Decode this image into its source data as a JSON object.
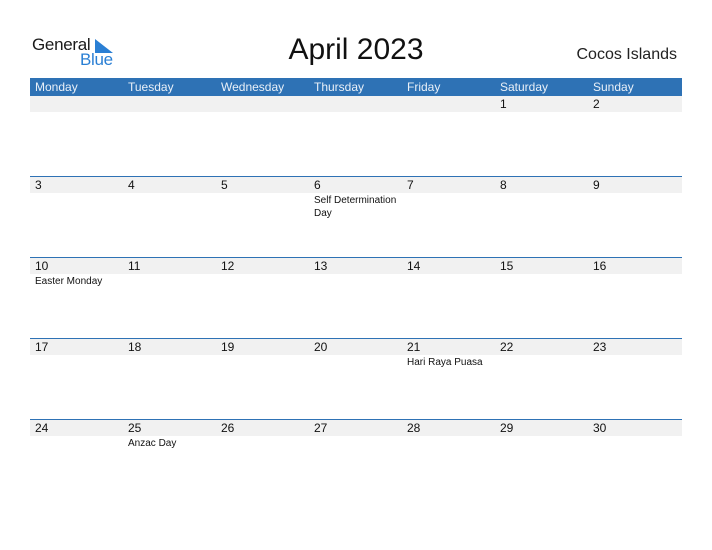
{
  "logo": {
    "part1": "General",
    "part2": "Blue"
  },
  "title": "April 2023",
  "country": "Cocos Islands",
  "colors": {
    "header": "#2e72b5",
    "logo_blue": "#2a7fd4",
    "band": "#f1f1f1"
  },
  "weekdays": [
    "Monday",
    "Tuesday",
    "Wednesday",
    "Thursday",
    "Friday",
    "Saturday",
    "Sunday"
  ],
  "weeks": [
    {
      "days": [
        {
          "num": "",
          "holiday": ""
        },
        {
          "num": "",
          "holiday": ""
        },
        {
          "num": "",
          "holiday": ""
        },
        {
          "num": "",
          "holiday": ""
        },
        {
          "num": "",
          "holiday": ""
        },
        {
          "num": "1",
          "holiday": ""
        },
        {
          "num": "2",
          "holiday": ""
        }
      ]
    },
    {
      "days": [
        {
          "num": "3",
          "holiday": ""
        },
        {
          "num": "4",
          "holiday": ""
        },
        {
          "num": "5",
          "holiday": ""
        },
        {
          "num": "6",
          "holiday": "Self Determination Day"
        },
        {
          "num": "7",
          "holiday": ""
        },
        {
          "num": "8",
          "holiday": ""
        },
        {
          "num": "9",
          "holiday": ""
        }
      ]
    },
    {
      "days": [
        {
          "num": "10",
          "holiday": "Easter Monday"
        },
        {
          "num": "11",
          "holiday": ""
        },
        {
          "num": "12",
          "holiday": ""
        },
        {
          "num": "13",
          "holiday": ""
        },
        {
          "num": "14",
          "holiday": ""
        },
        {
          "num": "15",
          "holiday": ""
        },
        {
          "num": "16",
          "holiday": ""
        }
      ]
    },
    {
      "days": [
        {
          "num": "17",
          "holiday": ""
        },
        {
          "num": "18",
          "holiday": ""
        },
        {
          "num": "19",
          "holiday": ""
        },
        {
          "num": "20",
          "holiday": ""
        },
        {
          "num": "21",
          "holiday": "Hari Raya Puasa"
        },
        {
          "num": "22",
          "holiday": ""
        },
        {
          "num": "23",
          "holiday": ""
        }
      ]
    },
    {
      "days": [
        {
          "num": "24",
          "holiday": ""
        },
        {
          "num": "25",
          "holiday": "Anzac Day"
        },
        {
          "num": "26",
          "holiday": ""
        },
        {
          "num": "27",
          "holiday": ""
        },
        {
          "num": "28",
          "holiday": ""
        },
        {
          "num": "29",
          "holiday": ""
        },
        {
          "num": "30",
          "holiday": ""
        }
      ]
    }
  ]
}
